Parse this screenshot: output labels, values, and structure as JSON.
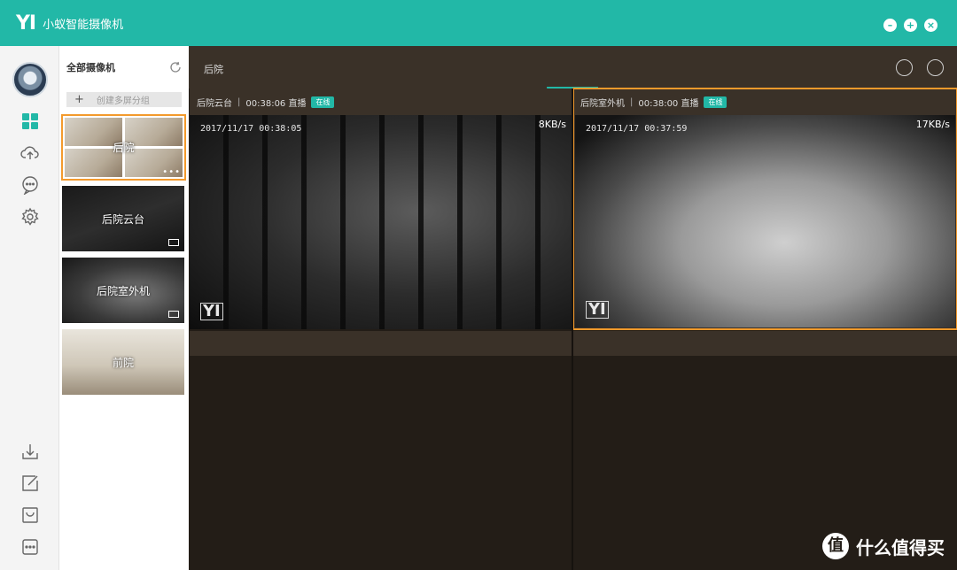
{
  "titlebar": {
    "logo": "YI",
    "title": "小蚁智能摄像机",
    "min_icon": "minimize-icon",
    "restore_icon": "restore-icon",
    "close_icon": "close-icon"
  },
  "rail": {
    "items": [
      {
        "name": "grid-view-icon",
        "active": true
      },
      {
        "name": "cloud-upload-icon",
        "active": false
      },
      {
        "name": "message-icon",
        "active": false
      },
      {
        "name": "settings-icon",
        "active": false
      }
    ],
    "bottom_items": [
      "download-icon",
      "edit-icon",
      "shop-icon",
      "more-icon"
    ]
  },
  "panel": {
    "heading": "全部摄像机",
    "create_group": "创建多屏分组",
    "cameras": [
      {
        "label": "后院",
        "selected": true
      },
      {
        "label": "后院云台",
        "selected": false
      },
      {
        "label": "后院室外机",
        "selected": false
      },
      {
        "label": "前院",
        "selected": false
      }
    ],
    "more": "•••"
  },
  "main": {
    "breadcrumb": "后院",
    "feeds": [
      {
        "name": "后院云台",
        "duration": "00:38:06 直播",
        "status": "在线",
        "timestamp": "2017/11/17 00:38:05",
        "rate": "8KB/s",
        "logo": "YI"
      },
      {
        "name": "后院室外机",
        "duration": "00:38:00 直播",
        "status": "在线",
        "timestamp": "2017/11/17 00:37:59",
        "rate": "17KB/s",
        "logo": "YI"
      }
    ]
  },
  "watermark": {
    "icon": "值",
    "text": "什么值得买"
  },
  "colors": {
    "accent": "#22b8a7",
    "selected": "#f39a2c",
    "dark_bg": "#231d17",
    "bar_bg": "#3a3128"
  }
}
